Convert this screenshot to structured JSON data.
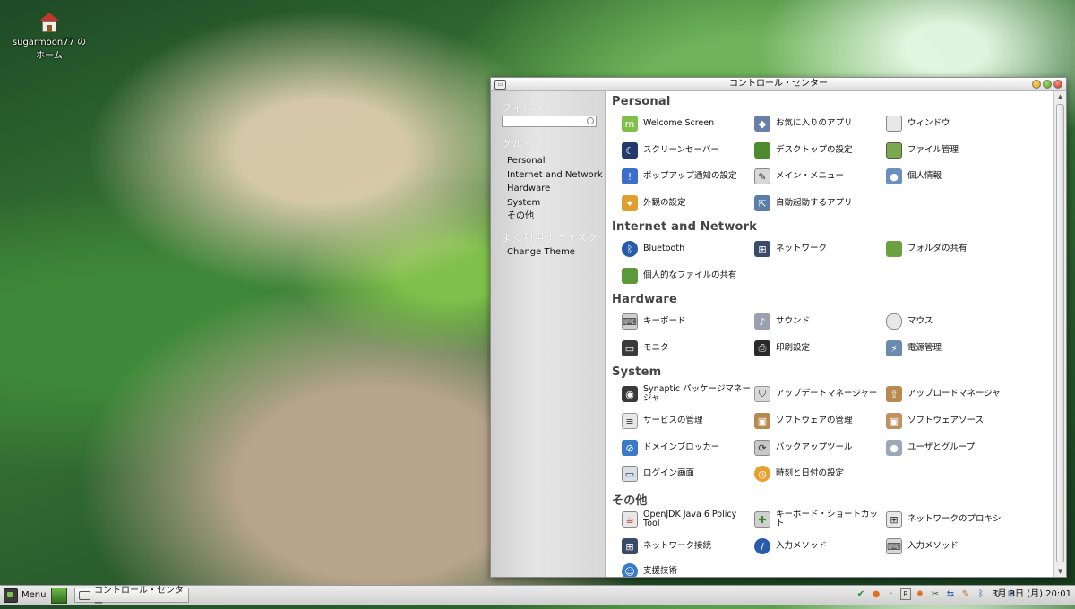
{
  "desktop": {
    "home_icon_label": "sugarmoon77 のホーム"
  },
  "window": {
    "title": "コントロール・センター",
    "icon": "window-icon"
  },
  "sidebar": {
    "filter_heading": "フィルタ",
    "filter_value": "",
    "group_heading": "グループ",
    "groups": [
      "Personal",
      "Internet and Network",
      "Hardware",
      "System",
      "その他"
    ],
    "tasks_heading": "よく利用するタスク",
    "tasks": [
      "Change Theme"
    ]
  },
  "sections": {
    "personal": {
      "title": "Personal",
      "items": [
        "Welcome Screen",
        "お気に入りのアプリ",
        "ウィンドウ",
        "スクリーンセーバー",
        "デスクトップの設定",
        "ファイル管理",
        "ポップアップ通知の設定",
        "メイン・メニュー",
        "個人情報",
        "外観の設定",
        "自動起動するアプリ"
      ]
    },
    "internet": {
      "title": "Internet and Network",
      "items": [
        "Bluetooth",
        "ネットワーク",
        "フォルダの共有",
        "個人的なファイルの共有"
      ]
    },
    "hardware": {
      "title": "Hardware",
      "items": [
        "キーボード",
        "サウンド",
        "マウス",
        "モニタ",
        "印刷設定",
        "電源管理"
      ]
    },
    "system": {
      "title": "System",
      "items": [
        "Synaptic パッケージマネージャ",
        "アップデートマネージャー",
        "アップロードマネージャ",
        "サービスの管理",
        "ソフトウェアの管理",
        "ソフトウェアソース",
        "ドメインブロッカー",
        "バックアップツール",
        "ユーザとグループ",
        "ログイン画面",
        "時刻と日付の設定"
      ]
    },
    "other": {
      "title": "その他",
      "items": [
        "OpenJDK Java 6 Policy Tool",
        "キーボード・ショートカット",
        "ネットワークのプロキシ",
        "ネットワーク接続",
        "入力メソッド",
        "入力メソッド",
        "支援技術"
      ]
    }
  },
  "taskbar": {
    "menu_label": "Menu",
    "task_label": "コントロール・センター",
    "clock": "3月 3日 (月) 20:01"
  }
}
